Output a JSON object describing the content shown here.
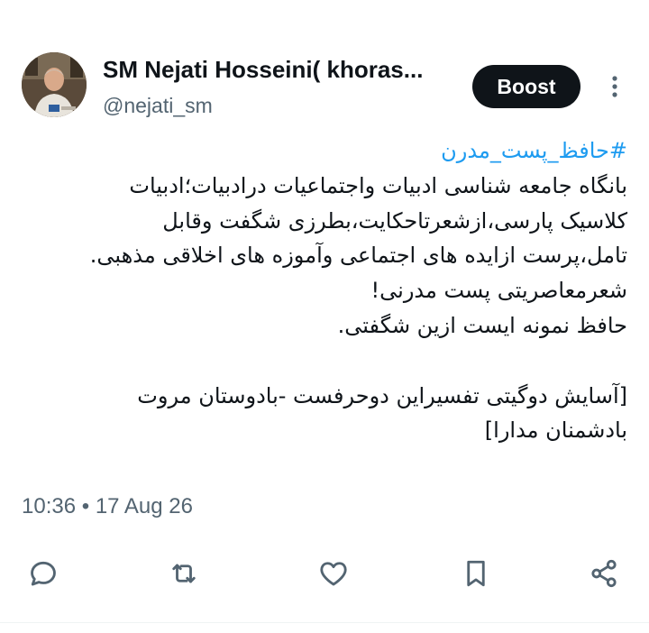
{
  "author": {
    "display_name": "SM Nejati Hosseini( khoras...",
    "handle": "@nejati_sm",
    "avatar_icon": "profile-photo"
  },
  "header": {
    "boost_label": "Boost",
    "more_icon": "vertical-ellipsis-icon"
  },
  "tweet": {
    "hashtag": "#حافظ_پست_مدرن",
    "lines": [
      "بانگاه جامعه شناسی ادبیات واجتماعیات درادبیات؛ادبیات",
      "کلاسیک پارسی،ازشعرتاحکایت،بطرزی شگفت وقابل",
      "تامل،پرست ازایده های اجتماعی وآموزه های اخلاقی مذهبی.",
      "شعرمعاصریتی پست مدرنی!",
      "حافظ نمونه ایست ازین شگفتی.",
      "",
      "[آسایش دوگیتی تفسیراین دوحرفست -بادوستان مروت",
      "بادشمنان مدارا]"
    ]
  },
  "meta": {
    "time": "10:36",
    "separator": "•",
    "date": "17 Aug 26"
  },
  "actions": {
    "icons": [
      "reply-icon",
      "retweet-icon",
      "like-icon",
      "bookmark-icon",
      "share-icon"
    ],
    "icon_color": "#536471"
  },
  "colors": {
    "hashtag": "#1d9bf0",
    "text": "#0f1419",
    "secondary": "#536471",
    "button_bg": "#0f1419"
  }
}
